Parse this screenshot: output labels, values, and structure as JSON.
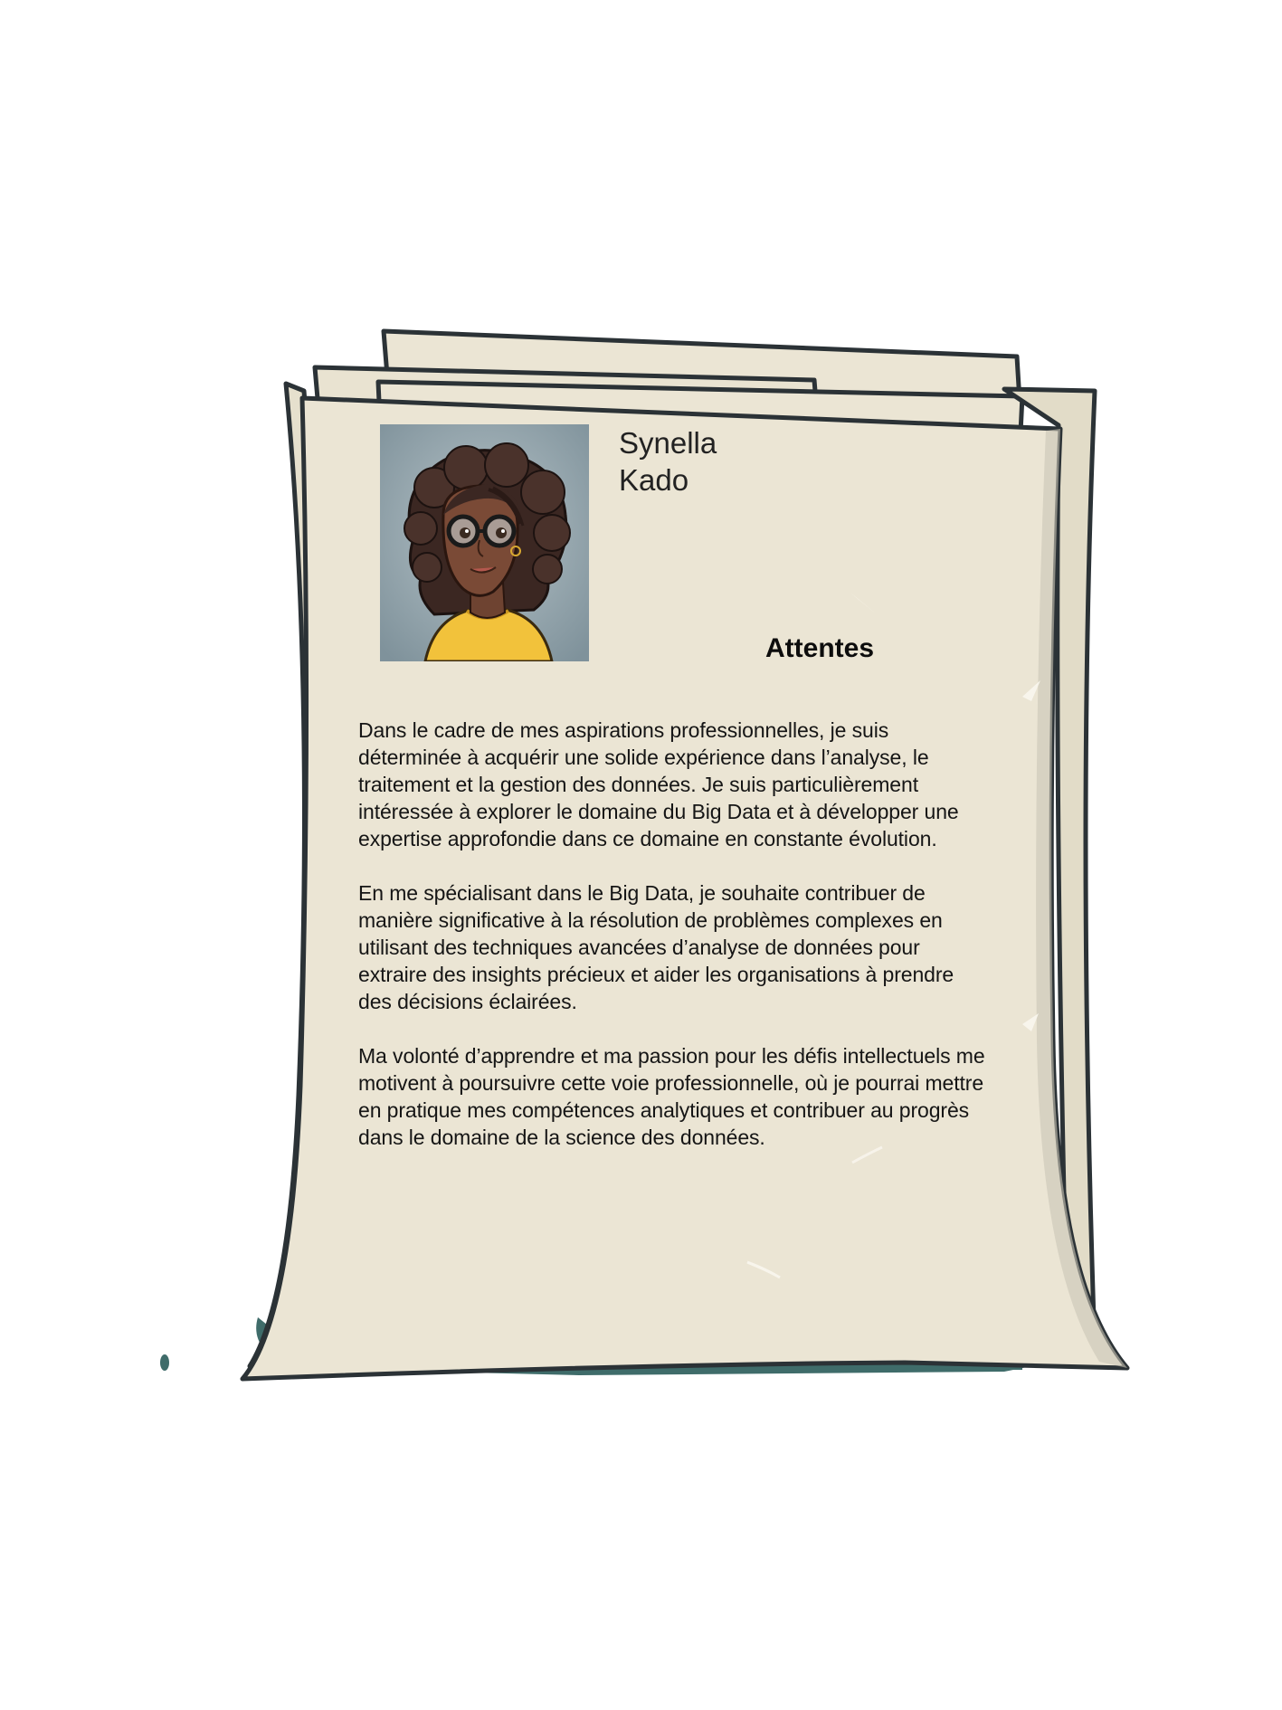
{
  "profile": {
    "first_name": "Synella",
    "last_name": "Kado",
    "portrait_icon": "cartoon-woman-avatar"
  },
  "section": {
    "title": "Attentes"
  },
  "paragraphs": [
    "Dans le cadre de mes aspirations professionnelles, je suis déterminée à acquérir une solide expérience dans l’analyse, le traitement et la gestion des données. Je suis particulièrement intéressée à explorer le domaine du Big Data et à développer une expertise approfondie dans ce domaine en constante évolution.",
    "En me spécialisant dans le Big Data, je souhaite contribuer de manière significative à la résolution de problèmes complexes en utilisant des techniques avancées d’analyse de données pour extraire des insights précieux et aider les organisations à prendre des décisions éclairées.",
    "Ma volonté d’apprendre et ma passion pour les défis intellectuels me motivent à poursuivre cette voie professionnelle, où je pourrai mettre en pratique mes compétences analytiques et contribuer au progrès dans le domaine de la science des données."
  ],
  "colors": {
    "paper": "#ebe5d4",
    "paper_back": "#e9e3d1",
    "outline": "#2b3236",
    "shadow": "#3f6c6a",
    "portrait_bg": "#8a9ba4",
    "shirt": "#f2c23b"
  }
}
